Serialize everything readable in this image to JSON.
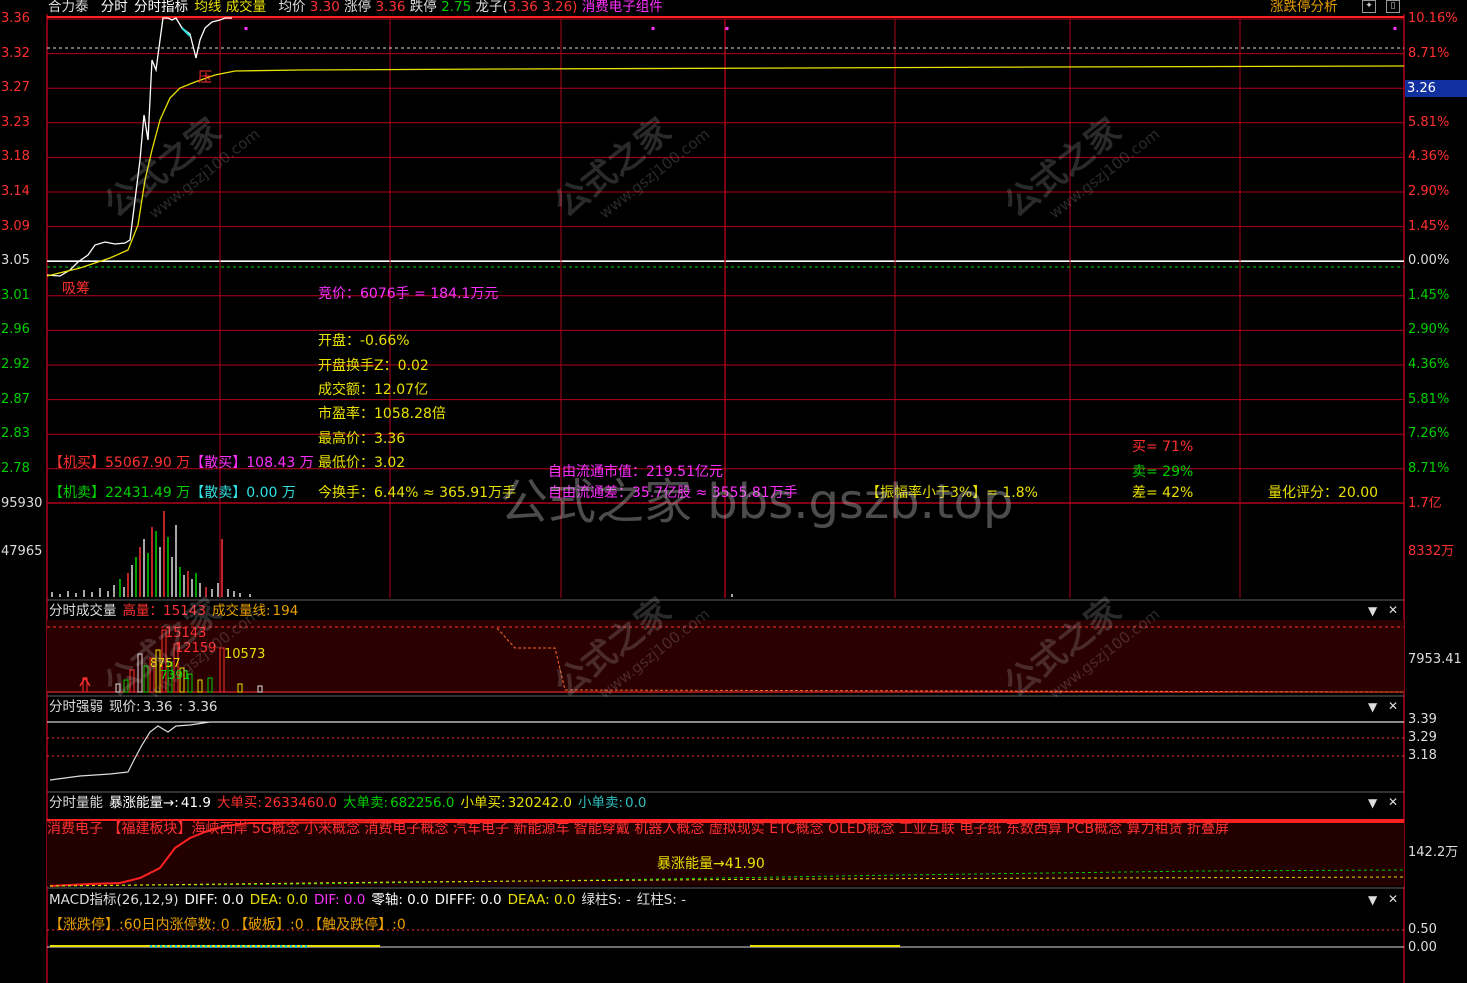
{
  "header": {
    "stock_name": "合力泰",
    "tabs": [
      "分时",
      "分时指标"
    ],
    "active_indicator": "均线",
    "volume_label": "成交量",
    "avg_label": "均价",
    "avg_value": "3.30",
    "limit_up_label": "涨停",
    "limit_up_value": "3.36",
    "limit_down_label": "跌停",
    "limit_down_value": "2.75",
    "dragon_label": "龙子(",
    "dragon_v1": "3.36",
    "dragon_v2": "3.26)",
    "sector": "消费电子组件",
    "right_link": "涨跌停分析"
  },
  "price_axis": {
    "left": [
      "3.36",
      "3.32",
      "3.27",
      "3.23",
      "3.18",
      "3.14",
      "3.09",
      "3.05",
      "3.01",
      "2.96",
      "2.92",
      "2.87",
      "2.83",
      "2.78"
    ],
    "right": [
      "10.16%",
      "8.71%",
      "7.26%",
      "5.81%",
      "4.36%",
      "2.90%",
      "1.45%",
      "0.00%",
      "1.45%",
      "2.90%",
      "4.36%",
      "5.81%",
      "7.26%",
      "8.71%"
    ],
    "current_price": "3.26"
  },
  "chart_marks": {
    "pressure": "压",
    "absorb": "吸筹"
  },
  "info": {
    "auction": "竞价：6076手 = 184.1万元",
    "open": "开盘：-0.66%",
    "open_turnover": "开盘换手Z：0.02",
    "amount": "成交额：12.07亿",
    "pe": "市盈率：1058.28倍",
    "high": "最高价：3.36",
    "low": "最低价：3.02",
    "turnover": "今换手：6.44% ≈ 365.91万手",
    "inst_buy_label": "【机买】",
    "inst_buy_value": "55067.90 万",
    "retail_buy_label": "【散买】",
    "retail_buy_value": "108.43 万",
    "inst_sell_label": "【机卖】",
    "inst_sell_value": "22431.49 万",
    "retail_sell_label": "【散卖】",
    "retail_sell_value": "0.00 万",
    "float_value": "自由流通市值：219.51亿元",
    "float_diff": "自由流通差：35.7亿股 ≈ 3555.81万手",
    "spread": "【振幅率小于3%】= 1.8%",
    "buy_pct": "买= 71%",
    "sell_pct": "卖= 29%",
    "diff_pct": "差= 42%",
    "quant_score": "量化评分：20.00"
  },
  "volume_panel": {
    "left_top": "95930",
    "left_mid": "47965",
    "right_top": "1.7亿",
    "right_mid": "8332万"
  },
  "panel_fsvol": {
    "title": "分时成交量",
    "high_label": "高量：",
    "high_value": "15143",
    "line_label": "成交量线:",
    "line_value": "194",
    "right_val": "7953.41",
    "tags": [
      "15143",
      "12159",
      "10573",
      "8757",
      "7391"
    ]
  },
  "panel_strength": {
    "title": "分时强弱",
    "price_label": "现价:",
    "price_value": "3.36",
    "price_value2": ": 3.36",
    "right_vals": [
      "3.39",
      "3.29",
      "3.18"
    ]
  },
  "panel_energy": {
    "title": "分时量能",
    "surge_label": "暴涨能量→:",
    "surge_value": "41.9",
    "big_buy_label": "大单买:",
    "big_buy_value": "2633460.0",
    "big_sell_label": "大单卖:",
    "big_sell_value": "682256.0",
    "small_buy_label": "小单买:",
    "small_buy_value": "320242.0",
    "small_sell_label": "小单卖:",
    "small_sell_value": "0.0",
    "concepts": "消费电子 【福建板块】海峡西岸 5G概念 小米概念 消费电子概念 汽车电子 新能源车 智能穿戴 机器人概念 虚拟现实 ETC概念 OLED概念 工业互联 电子纸 东数西算 PCB概念 算力租赁 折叠屏",
    "surge_note": "暴涨能量→41.90",
    "right_val": "142.2万"
  },
  "panel_macd": {
    "title": "MACD指标(26,12,9)",
    "diff": "DIFF: 0.0",
    "dea": "DEA: 0.0",
    "dif": "DIF: 0.0",
    "zero": "零轴: 0.0",
    "diff2": "DIFFF: 0.0",
    "deaa": "DEAA: 0.0",
    "green": "绿柱S: -",
    "red": "红柱S: -",
    "limit_row": "【涨跌停】:60日内涨停数: 0 【破板】:0 【触及跌停】:0",
    "right_vals": [
      "0.50",
      "0.00"
    ]
  },
  "watermarks": {
    "site": "公式之家",
    "url": "www.gszj100.com",
    "center": "公式之家 bbs.gszb.top"
  },
  "colors": {
    "grid": "#b0001a",
    "price": "#ffffff",
    "avg": "#e8e000",
    "up": "#ff3030",
    "down": "#00d000",
    "magenta": "#ff30ff",
    "cyan": "#30e0e0"
  }
}
